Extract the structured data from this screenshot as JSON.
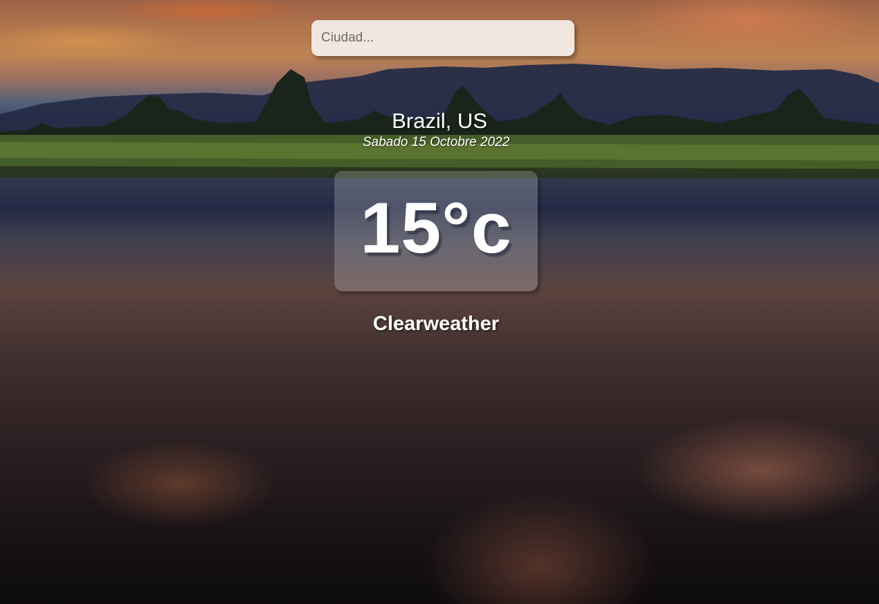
{
  "search": {
    "placeholder": "Ciudad...",
    "value": ""
  },
  "location": {
    "name": "Brazil, US",
    "date": "Sabado 15 Octobre 2022"
  },
  "weather": {
    "temperature": "15°c",
    "condition": "Clearweather"
  },
  "colors": {
    "text": "#ffffff",
    "search_background": "#e8e8e8"
  }
}
